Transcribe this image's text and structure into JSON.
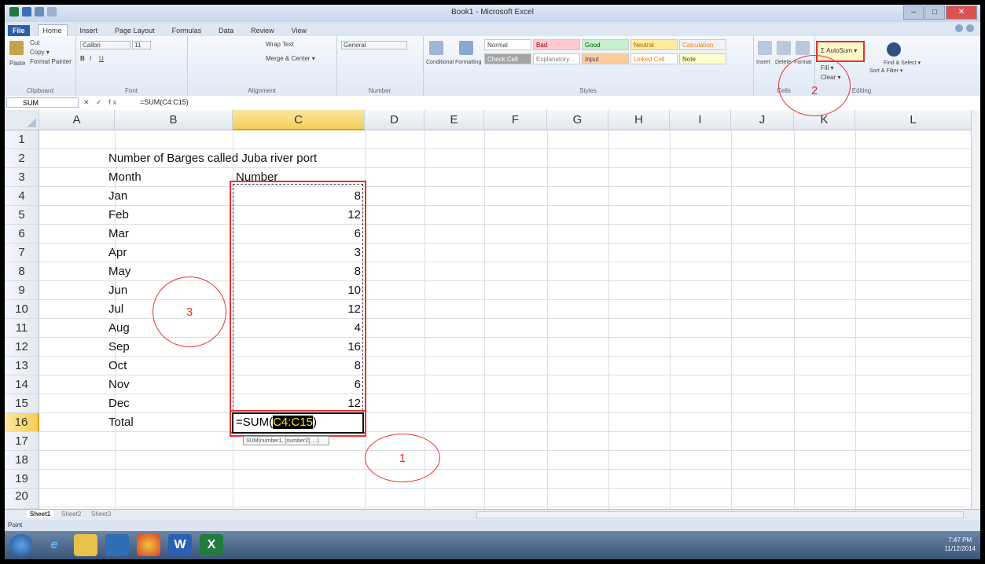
{
  "window": {
    "title": "Book1 - Microsoft Excel",
    "min": "–",
    "max": "□",
    "close": "✕"
  },
  "tabs": [
    "File",
    "Home",
    "Insert",
    "Page Layout",
    "Formulas",
    "Data",
    "Review",
    "View"
  ],
  "ribbon": {
    "clipboard": {
      "cut": "Cut",
      "copy": "Copy ▾",
      "paste": "Paste",
      "format_painter": "Format Painter",
      "label": "Clipboard"
    },
    "font": {
      "name": "Calibri",
      "size": "11",
      "bold": "B",
      "italic": "I",
      "underline": "U",
      "label": "Font"
    },
    "alignment": {
      "wrap": "Wrap Text",
      "merge": "Merge & Center ▾",
      "label": "Alignment"
    },
    "number": {
      "format": "General",
      "label": "Number"
    },
    "styles": {
      "conditional": "Conditional Formatting",
      "format_table": "Format as Table",
      "normal": "Normal",
      "bad": "Bad",
      "good": "Good",
      "neutral": "Neutral",
      "calculation": "Calculation",
      "check_cell": "Check Cell",
      "explanatory": "Explanatory...",
      "input": "Input",
      "linked_cell": "Linked Cell",
      "note": "Note",
      "label": "Styles"
    },
    "cells": {
      "insert": "Insert",
      "delete": "Delete",
      "format": "Format",
      "label": "Cells"
    },
    "editing": {
      "autosum": "Σ AutoSum ▾",
      "fill": "Fill ▾",
      "clear": "Clear ▾",
      "sort": "Sort & Filter ▾",
      "find": "Find & Select ▾",
      "label": "Editing"
    }
  },
  "formula_bar": {
    "name_box": "SUM",
    "fx": "✕ ✓ fx",
    "content": "=SUM(C4:C15)"
  },
  "columns": [
    "A",
    "B",
    "C",
    "D",
    "E",
    "F",
    "G",
    "H",
    "I",
    "J",
    "K",
    "L"
  ],
  "rows": [
    "1",
    "2",
    "3",
    "4",
    "5",
    "6",
    "7",
    "8",
    "9",
    "10",
    "11",
    "12",
    "13",
    "14",
    "15",
    "16",
    "17",
    "18",
    "19",
    "20"
  ],
  "sheet": {
    "title": "Number of Barges called Juba river port",
    "header_month": "Month",
    "header_number": "Number",
    "months": [
      "Jan",
      "Feb",
      "Mar",
      "Apr",
      "May",
      "Jun",
      "Jul",
      "Aug",
      "Sep",
      "Oct",
      "Nov",
      "Dec"
    ],
    "values": [
      "8",
      "12",
      "6",
      "3",
      "8",
      "10",
      "12",
      "4",
      "16",
      "8",
      "6",
      "12"
    ],
    "total_label": "Total",
    "formula_prefix": "=SUM(",
    "formula_range": "C4:C15",
    "formula_suffix": ")",
    "tooltip": "SUM(number1, [number2], ...)"
  },
  "callouts": {
    "one": "1",
    "two": "2",
    "three": "3"
  },
  "sheet_tabs": [
    "Sheet1",
    "Sheet2",
    "Sheet3"
  ],
  "status": "Point",
  "clock": {
    "time": "7:47 PM",
    "date": "11/12/2014"
  },
  "colors": {
    "accent_red": "#e8302e",
    "selection_yellow": "#f5cf59",
    "taskbar": "#3a5479"
  }
}
